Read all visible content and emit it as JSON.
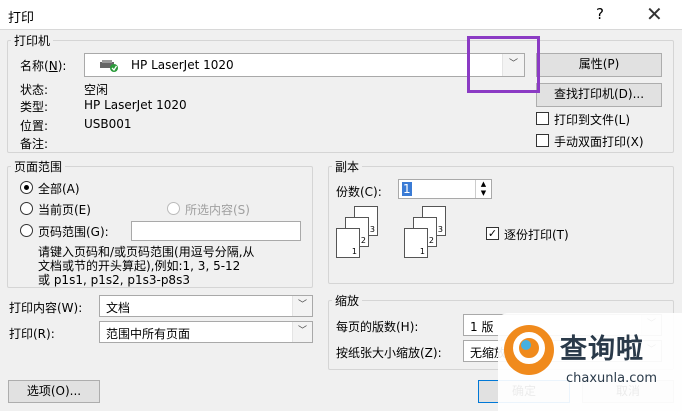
{
  "window": {
    "title": "打印",
    "help": "?",
    "close": "✕"
  },
  "printer": {
    "group_label": "打印机",
    "name_label_text": "名称",
    "name_label_key": "N",
    "selected": "HP LaserJet 1020",
    "properties_btn": "属性(P)",
    "find_btn": "查找打印机(D)...",
    "print_to_file": "打印到文件(L)",
    "print_to_file_checked": false,
    "manual_duplex": "手动双面打印(X)",
    "manual_duplex_checked": false,
    "status_label": "状态:",
    "status_value": "空闲",
    "type_label": "类型:",
    "type_value": "HP LaserJet 1020",
    "where_label": "位置:",
    "where_value": "USB001",
    "comment_label": "备注:"
  },
  "page_range": {
    "group_label": "页面范围",
    "all": "全部(A)",
    "current": "当前页(E)",
    "selection": "所选内容(S)",
    "pages": "页码范围(G):",
    "selected_option": "all",
    "hint_line1": "请键入页码和/或页码范围(用逗号分隔,从",
    "hint_line2": "文档或节的开头算起),例如:1, 3, 5-12",
    "hint_line3": "或 p1s1, p1s2, p1s3-p8s3"
  },
  "copies": {
    "group_label": "副本",
    "count_label": "份数(C):",
    "count_value": "1",
    "collate": "逐份打印(T)",
    "collate_checked": true,
    "stack_a": [
      "3",
      "2",
      "1"
    ],
    "stack_b": [
      "3",
      "2",
      "1"
    ]
  },
  "print_what": {
    "label": "打印内容(W):",
    "value": "文档"
  },
  "print": {
    "label": "打印(R):",
    "value": "范围中所有页面"
  },
  "zoom": {
    "group_label": "缩放",
    "pages_per_sheet_label": "每页的版数(H):",
    "pages_per_sheet_value": "1 版",
    "scale_label": "按纸张大小缩放(Z):",
    "scale_value": "无缩放"
  },
  "footer": {
    "options_btn": "选项(O)...",
    "ok_btn": "确定",
    "cancel_btn": "取消"
  },
  "watermark": {
    "name": "查询啦",
    "url": "chaxunla.com"
  },
  "colors": {
    "highlight": "#8b3bc4",
    "brand_orange": "#f08a1c"
  }
}
